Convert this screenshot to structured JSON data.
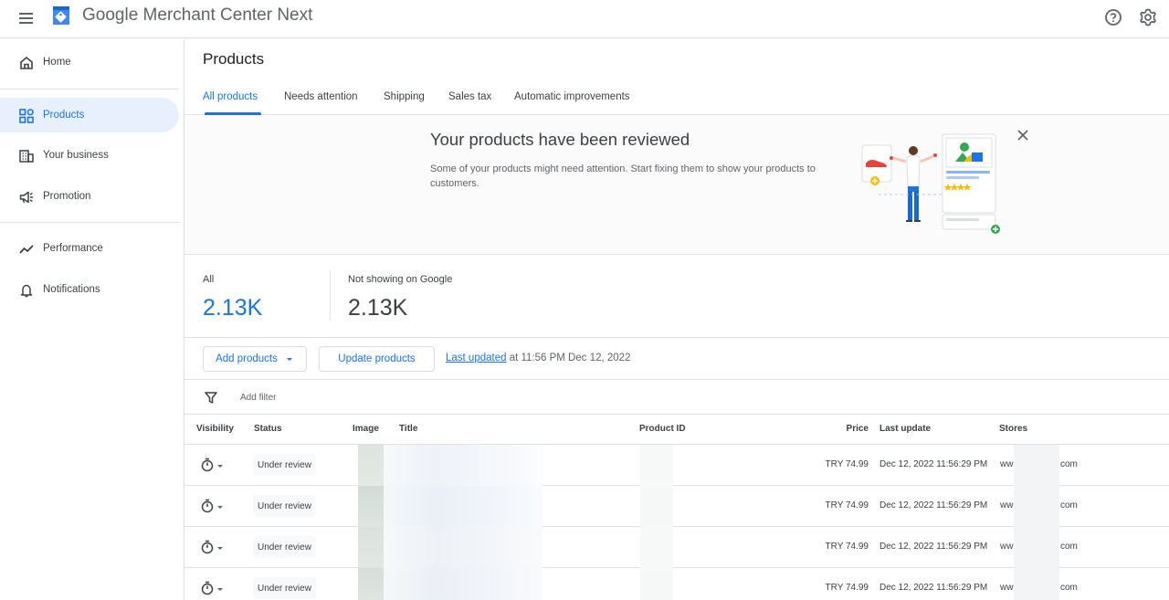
{
  "app": {
    "title": "Google Merchant Center Next"
  },
  "topbar": {
    "menu_icon": "menu-icon",
    "help_icon": "help-icon",
    "settings_icon": "settings-icon"
  },
  "sidebar": {
    "items": [
      {
        "label": "Home",
        "icon": "home-icon"
      },
      {
        "label": "Products",
        "icon": "products-icon",
        "active": true
      },
      {
        "label": "Your business",
        "icon": "business-icon"
      },
      {
        "label": "Promotion",
        "icon": "megaphone-icon"
      },
      {
        "label": "Performance",
        "icon": "trending-icon"
      },
      {
        "label": "Notifications",
        "icon": "bell-icon"
      }
    ]
  },
  "page": {
    "title": "Products"
  },
  "tabs": [
    {
      "label": "All products",
      "active": true
    },
    {
      "label": "Needs attention"
    },
    {
      "label": "Shipping"
    },
    {
      "label": "Sales tax"
    },
    {
      "label": "Automatic improvements"
    }
  ],
  "banner": {
    "title": "Your products have been reviewed",
    "text": "Some of your products might need attention. Start fixing them to show your products to customers."
  },
  "stats": [
    {
      "label": "All",
      "value": "2.13K",
      "color": "#1a73e8"
    },
    {
      "label": "Not showing on Google",
      "value": "2.13K",
      "color": "#3c4043"
    }
  ],
  "actions": {
    "add_products": "Add products",
    "update_products": "Update products",
    "last_updated_link": "Last updated",
    "last_updated_text": " at 11:56 PM Dec 12, 2022"
  },
  "filter": {
    "placeholder": "Add filter"
  },
  "table": {
    "columns": [
      "Visibility",
      "Status",
      "Image",
      "Title",
      "Product ID",
      "Price",
      "Last update",
      "Stores"
    ],
    "rows": [
      {
        "status": "Under review",
        "price": "TRY 74.99",
        "last_update": "Dec 12, 2022 11:56:29 PM",
        "store_prefix": "ww",
        "store_suffix": "com"
      },
      {
        "status": "Under review",
        "price": "TRY 74.99",
        "last_update": "Dec 12, 2022 11:56:29 PM",
        "store_prefix": "ww",
        "store_suffix": "com"
      },
      {
        "status": "Under review",
        "price": "TRY 74.99",
        "last_update": "Dec 12, 2022 11:56:29 PM",
        "store_prefix": "ww",
        "store_suffix": "com"
      },
      {
        "status": "Under review",
        "price": "TRY 74.99",
        "last_update": "Dec 12, 2022 11:56:29 PM",
        "store_prefix": "ww",
        "store_suffix": "com"
      }
    ]
  },
  "colors": {
    "accent": "#1a73e8",
    "active_nav_bg": "#e8f0fe",
    "border": "#e0e0e0"
  }
}
